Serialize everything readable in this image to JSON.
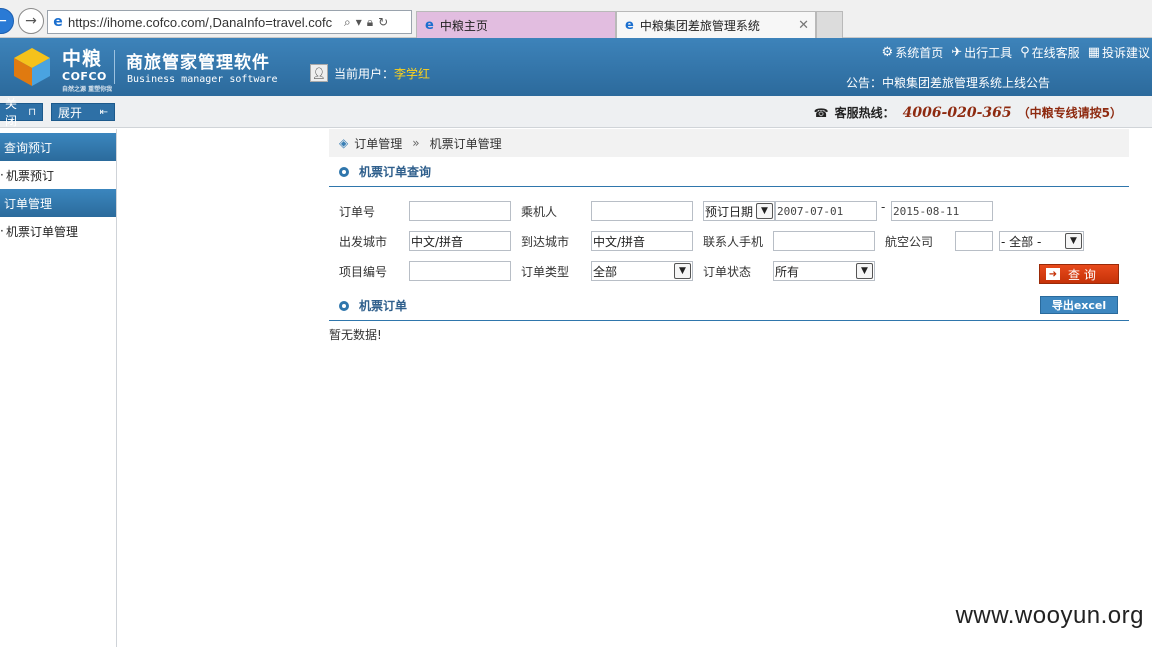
{
  "browser": {
    "url": "https://ihome.cofco.com/,DanaInfo=travel.cofc",
    "tabs": [
      {
        "label": "中粮主页"
      },
      {
        "label": "中粮集团差旅管理系统"
      }
    ]
  },
  "header": {
    "logo_cn": "中粮",
    "logo_en": "COFCO",
    "logo_sub": "自然之源 重塑你我",
    "brand_name": "商旅管家管理软件",
    "brand_en": "Business manager software",
    "user_label": "当前用户：",
    "user_name": "李学红",
    "links": [
      "系统首页",
      "出行工具",
      "在线客服",
      "投诉建议"
    ],
    "announcement": "公告：中粮集团差旅管理系统上线公告"
  },
  "toolbar": {
    "collapse_label": "关闭",
    "expand_label": "展开",
    "hotline_label": "客服热线：",
    "hotline_number": "4006-020-365",
    "hotline_note": "（中粮专线请按5）"
  },
  "sidebar": {
    "groups": [
      {
        "title": "查询预订",
        "items": [
          "机票预订"
        ]
      },
      {
        "title": "订单管理",
        "items": [
          "机票订单管理"
        ]
      }
    ]
  },
  "breadcrumb": {
    "root": "订单管理",
    "sep": "»",
    "current": "机票订单管理"
  },
  "query": {
    "title": "机票订单查询",
    "fields": {
      "order_no": {
        "label": "订单号",
        "value": ""
      },
      "passenger": {
        "label": "乘机人",
        "value": ""
      },
      "date_type": {
        "value": "预订日期"
      },
      "date_from": "2007-07-01",
      "date_dash": "-",
      "date_to": "2015-08-11",
      "dep_city": {
        "label": "出发城市",
        "value": "中文/拼音"
      },
      "arr_city": {
        "label": "到达城市",
        "value": "中文/拼音"
      },
      "contact_phone": {
        "label": "联系人手机",
        "value": ""
      },
      "airline": {
        "label": "航空公司",
        "value": "",
        "select": "- 全部 -"
      },
      "project_no": {
        "label": "项目编号",
        "value": ""
      },
      "order_type": {
        "label": "订单类型",
        "value": "全部"
      },
      "order_status": {
        "label": "订单状态",
        "value": "所有"
      }
    },
    "search_label": "查 询"
  },
  "orders": {
    "title": "机票订单",
    "export_label": "导出excel",
    "empty_message": "暂无数据!"
  },
  "watermark": "www.wooyun.org"
}
